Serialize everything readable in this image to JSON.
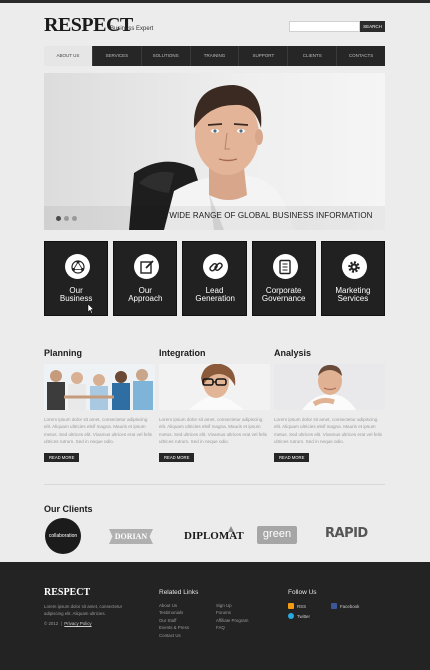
{
  "header": {
    "logo": "RESPECT",
    "tagline": "Business Expert",
    "search_placeholder": "",
    "search_button": "SEARCH"
  },
  "nav": {
    "items": [
      "ABOUT US",
      "SERVICES",
      "SOLUTIONS",
      "TRAINING",
      "SUPPORT",
      "CLIENTS",
      "CONTACTS"
    ],
    "active_index": 0
  },
  "hero": {
    "caption": "A WIDE RANGE OF GLOBAL BUSINESS INFORMATION",
    "slides": 3,
    "active_slide": 0
  },
  "tiles": [
    {
      "label": "Our Business",
      "icon": "network-icon"
    },
    {
      "label": "Our Approach",
      "icon": "edit-icon"
    },
    {
      "label": "Lead Generation",
      "icon": "link-icon"
    },
    {
      "label": "Corporate Governance",
      "icon": "book-icon"
    },
    {
      "label": "Marketing Services",
      "icon": "gear-icon"
    }
  ],
  "columns": [
    {
      "title": "Planning",
      "text": "Lorem ipsum dolor sit amet, consectetur adipiscing elit. Aliquam ultricies eleif magna. Mauris et ipsum metus. Sed ultrices elit. Vivamus ultrices erat vel felis ultrices rutrum. Sed in neque odio.",
      "button": "READ MORE"
    },
    {
      "title": "Integration",
      "text": "Lorem ipsum dolor sit amet, consectetur adipiscing elit. Aliquam ultricies eleif magna. Mauris et ipsum metus. Sed ultrices elit. Vivamus ultrices erat vel felis ultrices rutrum. Sed in neque odio.",
      "button": "READ MORE"
    },
    {
      "title": "Analysis",
      "text": "Lorem ipsum dolor sit amet, consectetur adipiscing elit. Aliquam ultricies eleif magna. Mauris et ipsum metus. Sed ultrices elit. Vivamus ultrices erat vel felis ultrices rutrum. Sed in neque odio.",
      "button": "READ MORE"
    }
  ],
  "clients": {
    "title": "Our Clients",
    "logos": [
      "collaboration",
      "DORIAN",
      "DIPLOMAT",
      "green",
      "RAPID"
    ]
  },
  "footer": {
    "logo": "RESPECT",
    "text": "Lorem ipsum dolor sit amet, consectetur adipiscing elit. Aliquam ultricies.",
    "copyright": "© 2012",
    "privacy": "Privacy Policy",
    "related_title": "Related Links",
    "links_col1": [
      "About Us",
      "Testimonials",
      "Our Staff",
      "Events & Press",
      "Contact Us"
    ],
    "links_col2": [
      "Sign Up",
      "Forums",
      "Affiliate Program",
      "FAQ"
    ],
    "follow_title": "Follow Us",
    "social": [
      {
        "label": "RSS",
        "color": "#f39c12",
        "icon": "rss-icon"
      },
      {
        "label": "Facebook",
        "color": "#3b5998",
        "icon": "facebook-icon"
      },
      {
        "label": "Twitter",
        "color": "#2aa9e0",
        "icon": "twitter-icon"
      }
    ]
  },
  "colors": {
    "dark": "#212121",
    "background": "#ececec",
    "accent_text": "#ffffff"
  }
}
